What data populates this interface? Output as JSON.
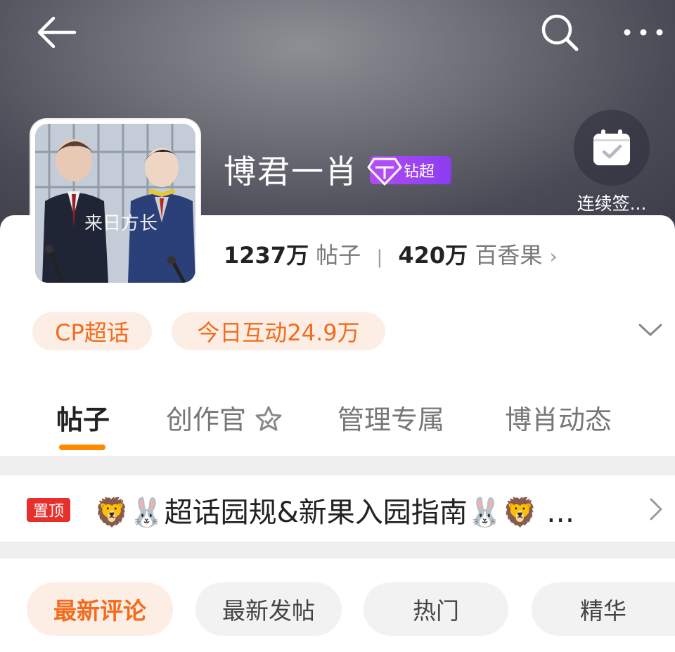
{
  "header": {
    "back_icon": "back-arrow-icon",
    "search_icon": "search-icon",
    "more_icon": "more-dots-icon",
    "checkin_label": "连续签..."
  },
  "topic": {
    "title": "博君一肖",
    "badge_label": "钻超",
    "badge_icon": "diamond-icon",
    "avatar_caption": "来日方长",
    "posts_count": "1237万",
    "posts_label": "帖子",
    "members_count": "420万",
    "members_label": "百香果",
    "stats_chevron": "›"
  },
  "tags": [
    "CP超话",
    "今日互动24.9万"
  ],
  "tabs": [
    {
      "label": "帖子",
      "active": true
    },
    {
      "label": "创作官",
      "icon": "star-badge-icon"
    },
    {
      "label": "管理专属"
    },
    {
      "label": "博肖动态"
    }
  ],
  "pinned": {
    "badge": "置顶",
    "text": "🦁🐰超话园规&新果入园指南🐰🦁 …"
  },
  "filters": [
    {
      "label": "最新评论",
      "active": true
    },
    {
      "label": "最新发帖"
    },
    {
      "label": "热门"
    },
    {
      "label": "精华"
    }
  ],
  "colors": {
    "accent": "#f36b1c",
    "underline": "#ff8a00",
    "badge_purple": "#9b45f2",
    "pin_red": "#e6302b"
  }
}
